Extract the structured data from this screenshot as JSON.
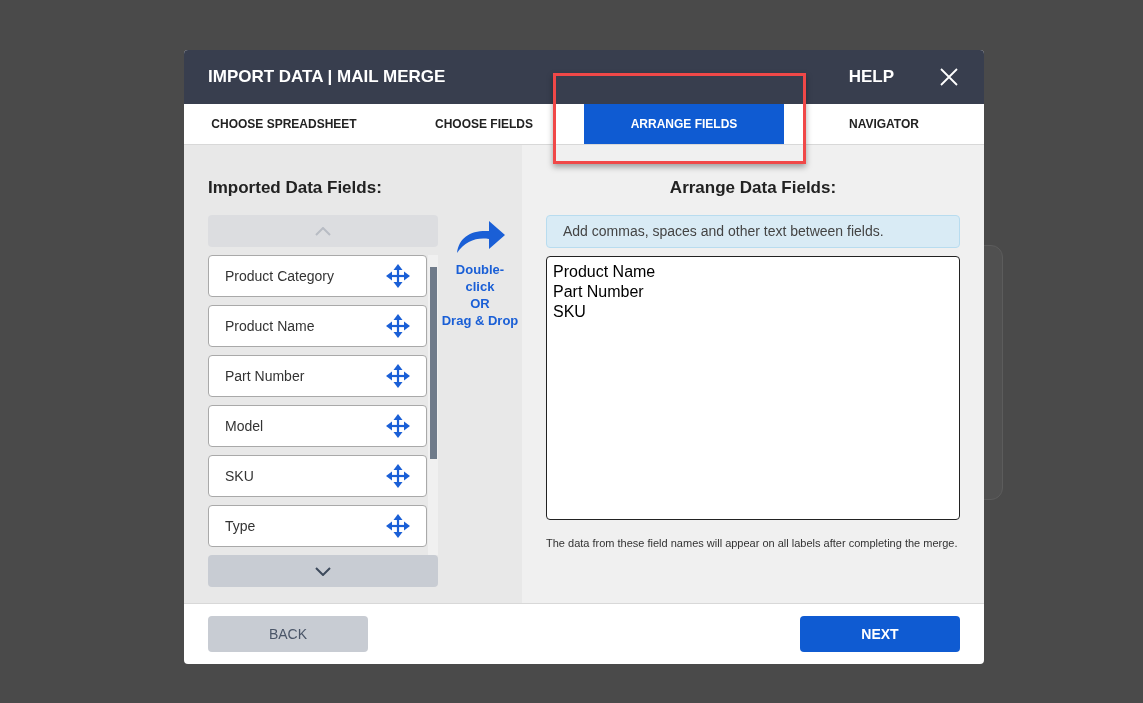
{
  "dialog": {
    "title": "IMPORT DATA | MAIL MERGE",
    "help": "HELP"
  },
  "tabs": [
    {
      "label": "CHOOSE SPREADSHEET",
      "selected": false
    },
    {
      "label": "CHOOSE FIELDS",
      "selected": false
    },
    {
      "label": "ARRANGE FIELDS",
      "selected": true
    },
    {
      "label": "NAVIGATOR",
      "selected": false
    }
  ],
  "imported": {
    "heading": "Imported Data Fields:",
    "fields": [
      "Product Category",
      "Product Name",
      "Part Number",
      "Model",
      "SKU",
      "Type"
    ]
  },
  "hint": [
    "Double-",
    "click",
    "OR",
    "Drag & Drop"
  ],
  "arrange": {
    "heading": "Arrange Data Fields:",
    "info": "Add commas, spaces and other text between fields.",
    "value_lines": [
      "Product Name",
      "Part Number",
      "SKU"
    ],
    "note": "The data from these field names will appear on all labels after completing the merge."
  },
  "footer": {
    "back": "BACK",
    "next": "NEXT"
  }
}
